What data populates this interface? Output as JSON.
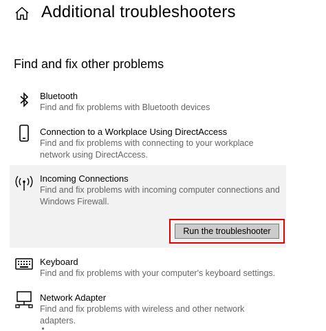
{
  "header": {
    "title": "Additional troubleshooters",
    "icon": "home-icon",
    "scrolled_text_fragment": "…  …  …  …  …  …  …  …  …  …"
  },
  "section": {
    "title": "Find and fix other problems"
  },
  "items": [
    {
      "icon": "bluetooth-icon",
      "name": "Bluetooth",
      "description": "Find and fix problems with Bluetooth devices"
    },
    {
      "icon": "phone-icon",
      "name": "Connection to a Workplace Using DirectAccess",
      "description": "Find and fix problems with connecting to your workplace network using DirectAccess."
    },
    {
      "icon": "wireless-antenna-icon",
      "name": "Incoming Connections",
      "description": "Find and fix problems with incoming computer connections and Windows Firewall.",
      "selected": true,
      "button_label": "Run the troubleshooter"
    },
    {
      "icon": "keyboard-icon",
      "name": "Keyboard",
      "description": "Find and fix problems with your computer's keyboard settings."
    },
    {
      "icon": "network-adapter-icon",
      "name": "Network Adapter",
      "description": "Find and fix problems with wireless and other network adapters."
    }
  ],
  "colors": {
    "highlight_border": "#e60000",
    "selected_background": "#f2f2f2",
    "button_background": "#cccccc",
    "description_text": "#666666"
  }
}
